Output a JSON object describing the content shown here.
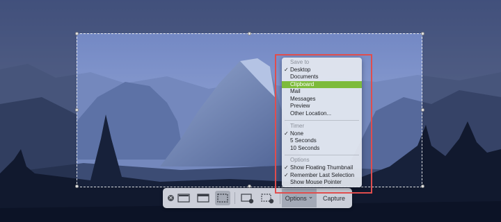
{
  "colors": {
    "menu_highlight": "#7dbb3b",
    "annotation_border": "#e04d4d",
    "sky": "#6f86c4",
    "mountain": "#5a6f9e"
  },
  "toolbar": {
    "close_icon": "close-circle-icon",
    "options_label": "Options",
    "options_chevron": "⌄",
    "capture_label": "Capture",
    "modes": [
      "capture-entire-screen-icon",
      "capture-window-icon",
      "capture-selection-icon",
      "record-entire-screen-icon",
      "record-selection-icon"
    ]
  },
  "menu": {
    "save_header": "Save to",
    "save_items": [
      {
        "label": "Desktop",
        "checked": true
      },
      {
        "label": "Documents"
      },
      {
        "label": "Clipboard",
        "highlighted": true
      },
      {
        "label": "Mail"
      },
      {
        "label": "Messages"
      },
      {
        "label": "Preview"
      },
      {
        "label": "Other Location..."
      }
    ],
    "timer_header": "Timer",
    "timer_items": [
      {
        "label": "None",
        "checked": true
      },
      {
        "label": "5 Seconds"
      },
      {
        "label": "10 Seconds"
      }
    ],
    "options_header": "Options",
    "options_items": [
      {
        "label": "Show Floating Thumbnail",
        "checked": true
      },
      {
        "label": "Remember Last Selection",
        "checked": true
      },
      {
        "label": "Show Mouse Pointer"
      }
    ],
    "checkmark": "✓"
  }
}
